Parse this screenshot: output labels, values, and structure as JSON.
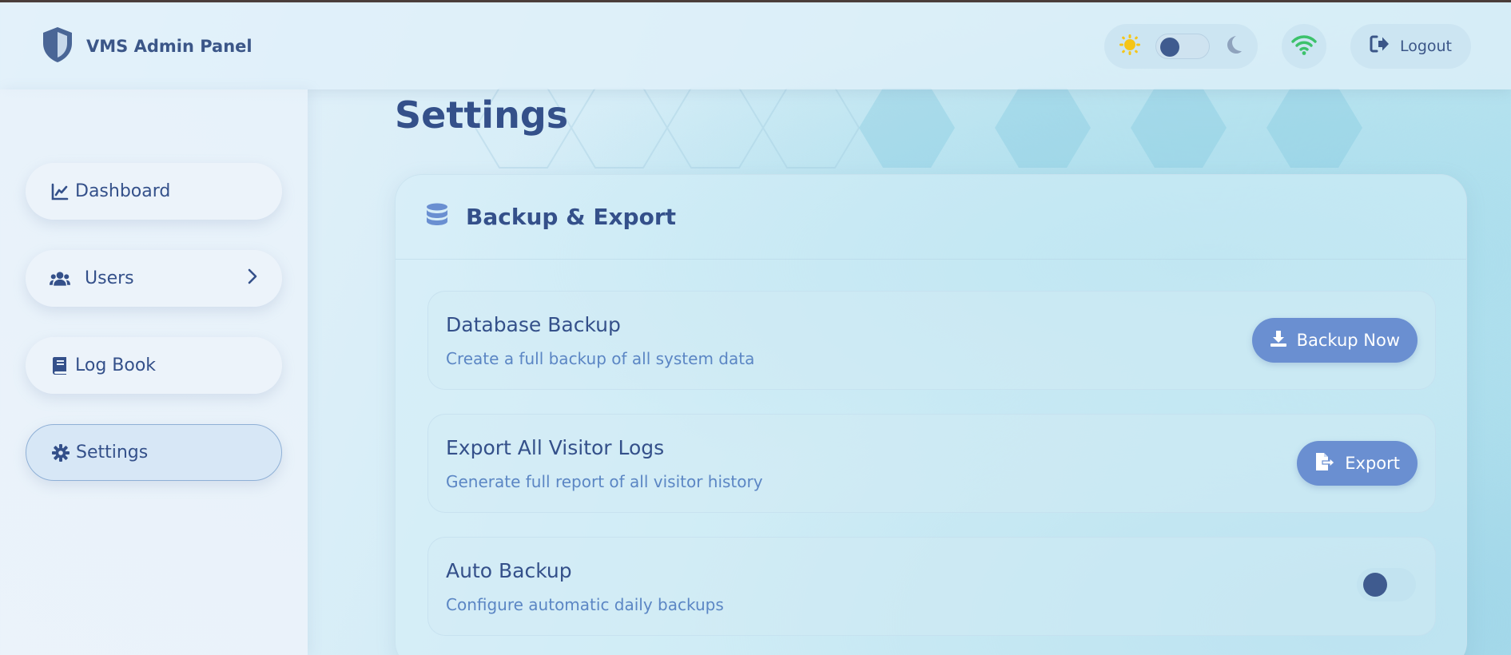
{
  "header": {
    "app_title": "VMS Admin Panel",
    "logout_label": "Logout",
    "icons": {
      "brand": "shield-icon",
      "sun": "sun-icon",
      "moon": "moon-icon",
      "wifi": "wifi-icon",
      "logout": "logout-icon"
    },
    "colors": {
      "sun": "#f5c518",
      "wifi": "#3cc26b",
      "moon": "#8fa3bd"
    }
  },
  "sidebar": {
    "items": [
      {
        "label": "Dashboard",
        "icon": "chart-line-icon"
      },
      {
        "label": "Users",
        "icon": "users-icon"
      },
      {
        "label": "Log Book",
        "icon": "book-icon"
      },
      {
        "label": "Settings",
        "icon": "gear-icon"
      }
    ],
    "active": "Settings"
  },
  "main": {
    "title": "Settings",
    "card": {
      "title": "Backup & Export",
      "icon": "database-icon",
      "rows": [
        {
          "title": "Database Backup",
          "description": "Create a full backup of all system data",
          "button_label": "Backup Now",
          "button_icon": "download-icon"
        },
        {
          "title": "Export All Visitor Logs",
          "description": "Generate full report of all visitor history",
          "button_label": "Export",
          "button_icon": "file-export-icon"
        },
        {
          "title": "Auto Backup",
          "description": "Configure automatic daily backups",
          "toggle_on": false
        }
      ]
    }
  },
  "theme": {
    "primary": "#6a8fd1",
    "text": "#34508a",
    "muted_text": "#5b86c4"
  }
}
